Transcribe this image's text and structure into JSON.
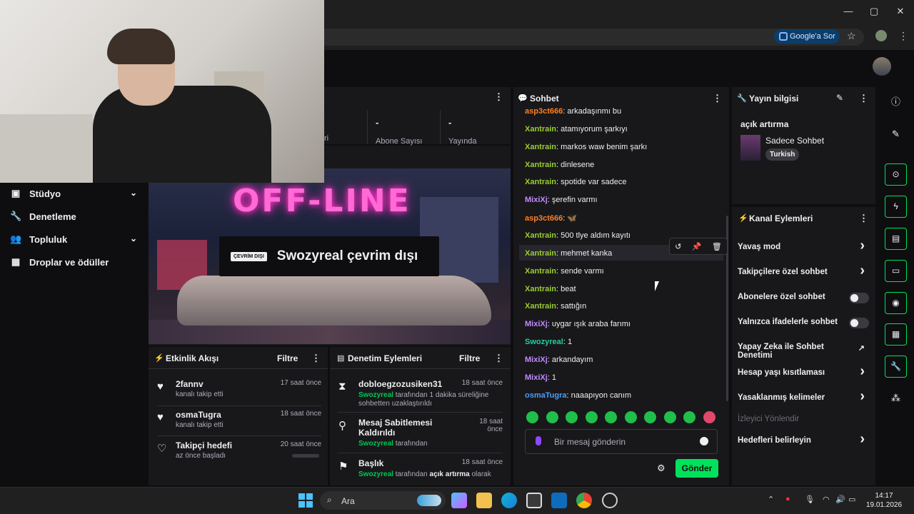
{
  "browser": {
    "google_ask": "Google'a Sor",
    "star_icon": "star-icon",
    "window_controls": [
      "—",
      "▢",
      "✕"
    ]
  },
  "nav": {
    "items": [
      {
        "label": "Stüdyo",
        "icon": "studio-icon",
        "chevron": true
      },
      {
        "label": "Denetleme",
        "icon": "wrench-icon",
        "chevron": false
      },
      {
        "label": "Topluluk",
        "icon": "community-icon",
        "chevron": true
      },
      {
        "label": "Droplar ve ödüller",
        "icon": "drops-icon",
        "chevron": false
      }
    ]
  },
  "stats": {
    "items": [
      {
        "value": "-",
        "label": "Abone Sayısı"
      },
      {
        "value": "-",
        "label": "Yayında"
      }
    ],
    "partial_label": "ri"
  },
  "preview": {
    "sign": "OFF-LINE",
    "badge": "ÇEVRİM DIŞI",
    "title": "Swozyreal çevrim dışı"
  },
  "activity": {
    "title": "Etkinlik Akışı",
    "filter": "Filtre",
    "items": [
      {
        "name": "2fannv",
        "sub": "kanalı takip etti",
        "time": "17 saat önce",
        "icon": "heart-icon"
      },
      {
        "name": "osmaTugra",
        "sub": "kanalı takip etti",
        "time": "18 saat önce",
        "icon": "heart-icon"
      },
      {
        "name": "Takipçi hedefi",
        "sub": "az önce başladı",
        "time": "20 saat önce",
        "icon": "heart-outline-icon"
      }
    ]
  },
  "mod_actions": {
    "title": "Denetim Eylemleri",
    "filter": "Filtre",
    "items": [
      {
        "name": "dobloegzozusiken31",
        "actor": "Swozyreal",
        "desc": "tarafından 1 dakika süreliğine sohbetten uzaklaştırıldı",
        "time": "18 saat önce",
        "icon": "hourglass-icon"
      },
      {
        "name": "Mesaj Sabitlemesi Kaldırıldı",
        "actor": "Swozyreal",
        "desc": "tarafından",
        "time": "18 saat önce",
        "icon": "unpin-icon"
      },
      {
        "name": "Başlık",
        "actor": "Swozyreal",
        "desc": "tarafından",
        "bold": "açık artırma",
        "desc2": "olarak",
        "time": "18 saat önce",
        "icon": "title-icon"
      }
    ]
  },
  "chat": {
    "title": "Sohbet",
    "messages": [
      {
        "user": "asp3ct666",
        "color": "#ff7f24",
        "text": "arkadaşınmı bu"
      },
      {
        "user": "Xantrain",
        "color": "#9acd32",
        "text": "atamıyorum şarkıyı"
      },
      {
        "user": "Xantrain",
        "color": "#9acd32",
        "text": "markos waw benim şarkı"
      },
      {
        "user": "Xantrain",
        "color": "#9acd32",
        "text": "dinlesene"
      },
      {
        "user": "Xantrain",
        "color": "#9acd32",
        "text": "spotide var sadece"
      },
      {
        "user": "MixiXj",
        "color": "#c28aff",
        "text": "şerefin varmı"
      },
      {
        "user": "asp3ct666",
        "color": "#ff7f24",
        "text": "🦋"
      },
      {
        "user": "Xantrain",
        "color": "#9acd32",
        "text": "500 tlye aldım kayıtı"
      },
      {
        "user": "Xantrain",
        "color": "#9acd32",
        "text": "mehmet kanka"
      },
      {
        "user": "Xantrain",
        "color": "#9acd32",
        "text": "sende varmı"
      },
      {
        "user": "Xantrain",
        "color": "#9acd32",
        "text": "beat"
      },
      {
        "user": "Xantrain",
        "color": "#9acd32",
        "text": "sattığın"
      },
      {
        "user": "MixiXj",
        "color": "#c28aff",
        "text": "uygar ışık araba farımı"
      },
      {
        "user": "Swozyreal",
        "color": "#1fd1a0",
        "text": "1"
      },
      {
        "user": "MixiXj",
        "color": "#c28aff",
        "text": "arkandayım"
      },
      {
        "user": "MixiXj",
        "color": "#c28aff",
        "text": "1"
      },
      {
        "user": "osmaTugra",
        "color": "#4a9cff",
        "text": "naaapıyon canım"
      }
    ],
    "placeholder": "Bir mesaj gönderin",
    "send": "Gönder"
  },
  "stream_info": {
    "title": "Yayın bilgisi",
    "stream_title": "açık artırma",
    "category": "Sadece Sohbet",
    "tag": "Turkish"
  },
  "channel_actions": {
    "title": "Kanal Eylemleri",
    "rows": [
      {
        "label": "Yavaş mod",
        "type": "arrow"
      },
      {
        "label": "Takipçilere özel sohbet",
        "type": "arrow"
      },
      {
        "label": "Abonelere özel sohbet",
        "type": "toggle"
      },
      {
        "label": "Yalnızca ifadelerle sohbet",
        "type": "toggle"
      },
      {
        "label": "Yapay Zeka ile Sohbet Denetimi",
        "type": "external"
      },
      {
        "label": "Hesap yaşı kısıtlaması",
        "type": "arrow"
      },
      {
        "label": "Yasaklanmış kelimeler",
        "type": "arrow"
      },
      {
        "label": "İzleyici Yönlendir",
        "type": "disabled"
      },
      {
        "label": "Hedefleri belirleyin",
        "type": "arrow"
      }
    ]
  },
  "taskbar": {
    "search": "Ara",
    "time": "14:17",
    "date": "19.01.2026"
  }
}
